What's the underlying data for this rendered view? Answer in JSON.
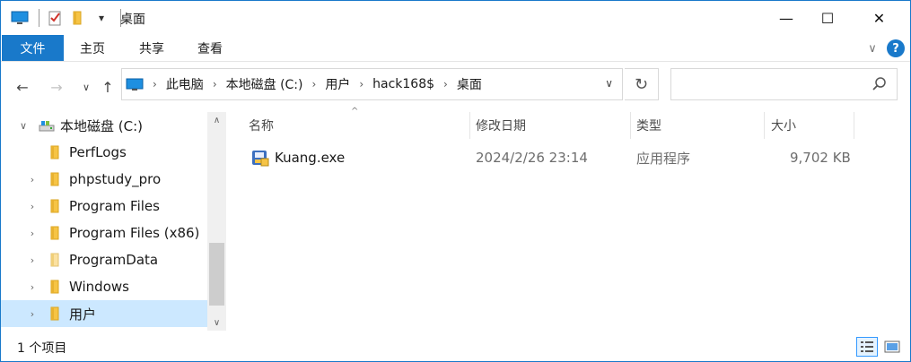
{
  "titlebar": {
    "title": "桌面",
    "minimize_glyph": "—",
    "maximize_glyph": "☐",
    "close_glyph": "✕",
    "qat_dropdown_glyph": "▾"
  },
  "ribbon": {
    "tabs": {
      "file": "文件",
      "home": "主页",
      "share": "共享",
      "view": "查看"
    },
    "help_glyph": "?",
    "collapse_glyph": "∨"
  },
  "nav": {
    "back_glyph": "←",
    "forward_glyph": "→",
    "recent_glyph": "∨",
    "up_glyph": "↑",
    "breadcrumbs": [
      "此电脑",
      "本地磁盘 (C:)",
      "用户",
      "hack168$",
      "桌面"
    ],
    "crumb_separator": "›",
    "address_dropdown_glyph": "∨",
    "refresh_glyph": "↻",
    "search_placeholder": ""
  },
  "tree": {
    "items": [
      {
        "label": "本地磁盘 (C:)",
        "chevron": "∨",
        "icon": "drive-icon"
      },
      {
        "label": "PerfLogs",
        "chevron": "",
        "icon": "folder-icon"
      },
      {
        "label": "phpstudy_pro",
        "chevron": "›",
        "icon": "folder-icon"
      },
      {
        "label": "Program Files",
        "chevron": "›",
        "icon": "folder-icon"
      },
      {
        "label": "Program Files (x86)",
        "chevron": "›",
        "icon": "folder-icon"
      },
      {
        "label": "ProgramData",
        "chevron": "›",
        "icon": "folder-icon"
      },
      {
        "label": "Windows",
        "chevron": "›",
        "icon": "folder-icon"
      },
      {
        "label": "用户",
        "chevron": "›",
        "icon": "folder-icon",
        "selected": true
      }
    ],
    "scroll_up_glyph": "∧",
    "scroll_down_glyph": "∨"
  },
  "content": {
    "columns": {
      "name": "名称",
      "modified": "修改日期",
      "type": "类型",
      "size": "大小"
    },
    "sort_glyph": "^",
    "files": [
      {
        "name": "Kuang.exe",
        "modified": "2024/2/26 23:14",
        "type": "应用程序",
        "size": "9,702 KB",
        "icon": "exe-setup-icon"
      }
    ]
  },
  "status": {
    "item_count": "1 个项目"
  },
  "colors": {
    "accent": "#1979ca",
    "selection": "#cce8ff",
    "folder": "#f6c445"
  }
}
